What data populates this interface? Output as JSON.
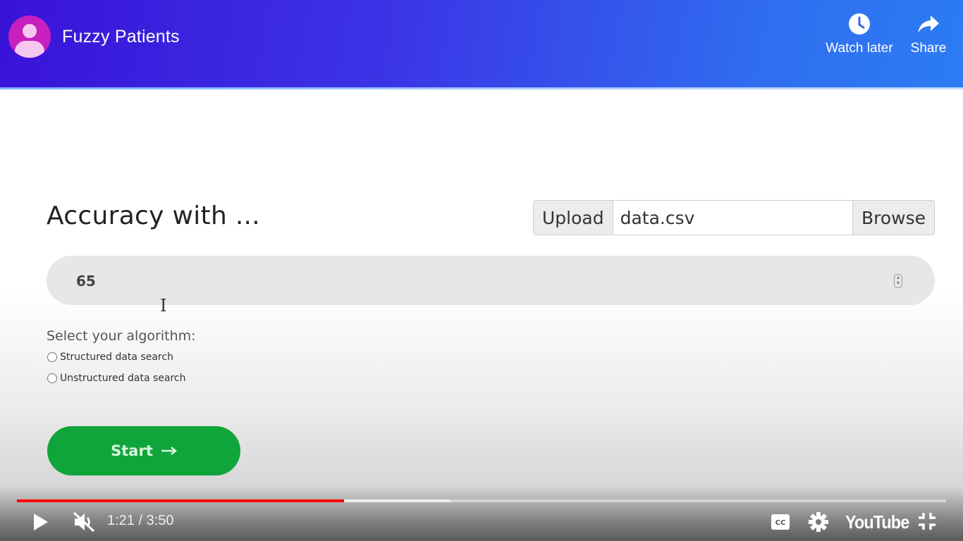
{
  "header": {
    "channel_title": "Fuzzy Patients",
    "watch_later_label": "Watch later",
    "share_label": "Share",
    "icons": {
      "avatar": "user-avatar-icon",
      "watch_later": "clock-icon",
      "share": "share-arrow-icon"
    }
  },
  "content": {
    "heading": "Accuracy with ...",
    "upload": {
      "button_label": "Upload",
      "file_name": "data.csv",
      "browse_label": "Browse"
    },
    "accuracy_value": "65",
    "algorithm": {
      "label": "Select your algorithm:",
      "options": [
        "Structured data search",
        "Unstructured data search"
      ]
    },
    "start_label": "Start",
    "start_icon": "arrow-right-icon"
  },
  "player": {
    "current_time": "1:21",
    "duration": "3:50",
    "time_text": "1:21 / 3:50",
    "progress_fraction": 0.3522,
    "buffered_fraction": 0.4666,
    "logo_text": "YouTube",
    "icons": [
      "play-icon",
      "muted-icon",
      "captions-icon",
      "settings-icon",
      "exit-fullscreen-icon"
    ],
    "colors": {
      "played": "#ff0000",
      "start_button": "#10a53a"
    }
  }
}
